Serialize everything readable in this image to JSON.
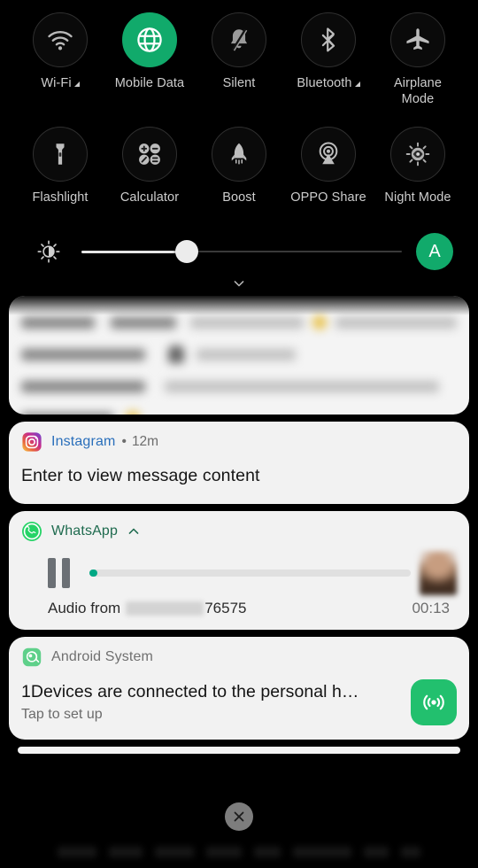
{
  "quick_settings": {
    "row1": [
      {
        "label": "Wi-Fi",
        "icon": "wifi-icon",
        "active": false,
        "expandable": true
      },
      {
        "label": "Mobile Data",
        "icon": "globe-icon",
        "active": true,
        "expandable": false
      },
      {
        "label": "Silent",
        "icon": "bell-off-icon",
        "active": false,
        "expandable": false
      },
      {
        "label": "Bluetooth",
        "icon": "bluetooth-icon",
        "active": false,
        "expandable": true
      },
      {
        "label": "Airplane\nMode",
        "icon": "airplane-icon",
        "active": false,
        "expandable": false
      }
    ],
    "row2": [
      {
        "label": "Flashlight",
        "icon": "flashlight-icon",
        "active": false,
        "expandable": false
      },
      {
        "label": "Calculator",
        "icon": "calculator-icon",
        "active": false,
        "expandable": false
      },
      {
        "label": "Boost",
        "icon": "rocket-icon",
        "active": false,
        "expandable": false
      },
      {
        "label": "OPPO Share",
        "icon": "oppo-share-icon",
        "active": false,
        "expandable": false
      },
      {
        "label": "Night Mode",
        "icon": "night-mode-eye-icon",
        "active": false,
        "expandable": false
      }
    ]
  },
  "brightness": {
    "icon": "brightness-icon",
    "value_percent": 33,
    "auto_label": "A",
    "auto_enabled": true,
    "expand_icon": "chevron-down-icon"
  },
  "notifications": [
    {
      "id": "redacted-card",
      "type": "blurred",
      "app": ""
    },
    {
      "id": "instagram-card",
      "app": "Instagram",
      "icon": "instagram-icon",
      "separator": "•",
      "time": "12m",
      "body": "Enter to view message content"
    },
    {
      "id": "whatsapp-card",
      "app": "WhatsApp",
      "icon": "whatsapp-icon",
      "collapse_icon": "chevron-up-icon",
      "player": {
        "state_icon": "pause-icon",
        "progress_percent": 2.6,
        "from_prefix": "Audio from",
        "from_number": "76575",
        "duration": "00:13"
      }
    },
    {
      "id": "android-system-card",
      "app": "Android System",
      "icon": "android-system-icon",
      "title": "1Devices are connected to the personal h…",
      "subtitle": "Tap to set up",
      "action_icon": "hotspot-icon"
    }
  ],
  "bottom": {
    "close_icon": "close-icon"
  },
  "colors": {
    "accent_green": "#11aa6b",
    "whatsapp_green": "#25d366",
    "whatsapp_text": "#1f6b4f",
    "instagram_text": "#2a6fbb",
    "card_background": "#f2f2f2",
    "screen_background": "#000000",
    "audio_progress": "#00a884",
    "hotspot_button": "#22c06e"
  }
}
